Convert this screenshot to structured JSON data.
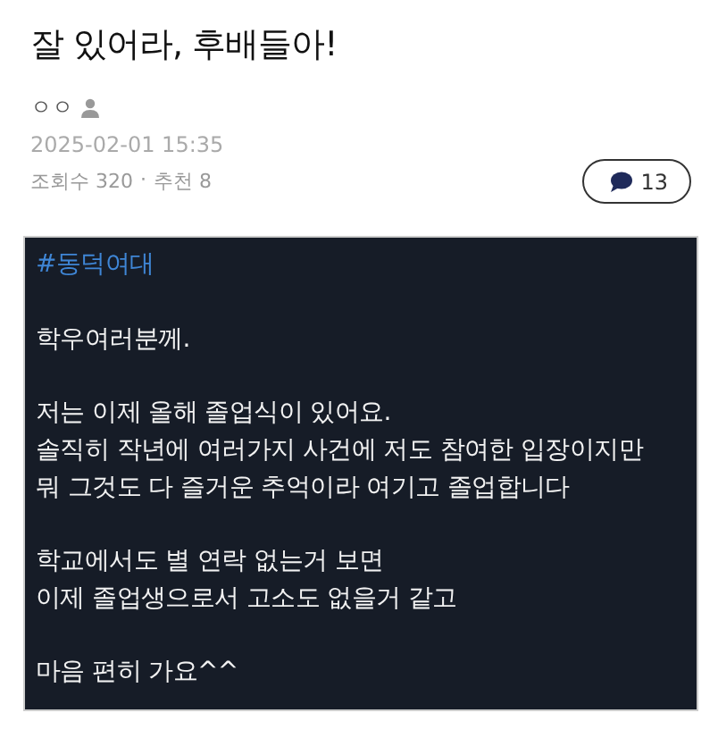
{
  "post": {
    "title": "잘 있어라, 후배들아!",
    "author": "ㅇㅇ",
    "date": "2025-02-01 15:35",
    "views": "조회수 320",
    "separator": "·",
    "recommends": "추천 8",
    "comment_count": "13"
  },
  "image": {
    "hashtag": "#동덕여대",
    "paragraphs": [
      [
        "학우여러분께."
      ],
      [
        "저는 이제 올해 졸업식이 있어요.",
        "솔직히 작년에 여러가지 사건에 저도 참여한 입장이지만",
        "뭐 그것도 다 즐거운 추억이라 여기고 졸업합니다"
      ],
      [
        "학교에서도 별 연락 없는거 보면",
        "이제 졸업생으로서 고소도 없을거 같고"
      ],
      [
        "마음 편히 가요^^"
      ]
    ]
  }
}
